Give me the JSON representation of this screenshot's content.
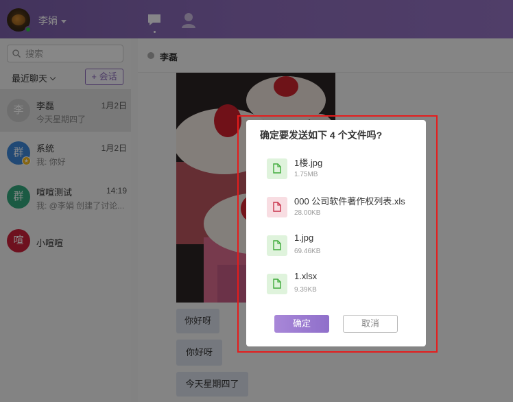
{
  "header": {
    "user_name": "李娟"
  },
  "sidebar": {
    "search_placeholder": "搜索",
    "recent_label": "最近聊天",
    "new_chat_label": "+ 会话",
    "conversations": [
      {
        "avatar_text": "李",
        "avatar_color": "#c8c8c8",
        "name": "李磊",
        "time": "1月2日",
        "preview": "今天星期四了"
      },
      {
        "avatar_text": "群",
        "avatar_color": "#3d86d6",
        "name": "系统",
        "time": "1月2日",
        "preview": "我: 你好"
      },
      {
        "avatar_text": "群",
        "avatar_color": "#32a57a",
        "name": "喧喧测试",
        "time": "14:19",
        "preview": "我: @李娟 创建了讨论..."
      },
      {
        "avatar_text": "喧",
        "avatar_color": "#c9203a",
        "name": "小喧喧",
        "time": "",
        "preview": ""
      }
    ]
  },
  "chat": {
    "title": "李磊",
    "messages": [
      "你好呀",
      "你好呀",
      "今天星期四了"
    ]
  },
  "dialog": {
    "title": "确定要发送如下 4 个文件吗?",
    "files": [
      {
        "name": "1楼.jpg",
        "size": "1.75MB",
        "type": "image"
      },
      {
        "name": "000 公司软件著作权列表.xls",
        "size": "28.00KB",
        "type": "spreadsheet"
      },
      {
        "name": "1.jpg",
        "size": "69.46KB",
        "type": "image"
      },
      {
        "name": "1.xlsx",
        "size": "9.39KB",
        "type": "spreadsheet"
      }
    ],
    "confirm_label": "确定",
    "cancel_label": "取消"
  },
  "colors": {
    "accent": "#8b6bb8",
    "highlight": "#e51c1c"
  }
}
